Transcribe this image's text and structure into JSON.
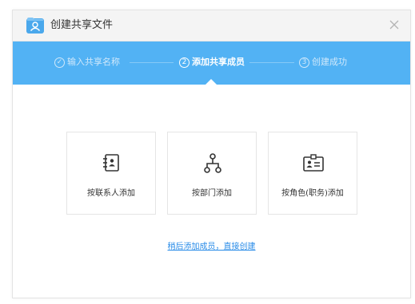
{
  "dialog": {
    "title": "创建共享文件",
    "close_icon": "close-icon",
    "title_icon": "shared-folder-icon"
  },
  "steps": [
    {
      "number": "✓",
      "label": "输入共享名称",
      "state": "done"
    },
    {
      "number": "2",
      "label": "添加共享成员",
      "state": "current"
    },
    {
      "number": "3",
      "label": "创建成功",
      "state": "pending"
    }
  ],
  "options": [
    {
      "label": "按联系人添加",
      "icon": "contacts-book-icon"
    },
    {
      "label": "按部门添加",
      "icon": "org-chart-icon"
    },
    {
      "label": "按角色(职务)添加",
      "icon": "id-card-icon"
    }
  ],
  "skip_link": "稍后添加成员，直接创建",
  "colors": {
    "accent": "#52b2f4",
    "link": "#2a8ce8",
    "titlebar": "#f4f4f4"
  }
}
